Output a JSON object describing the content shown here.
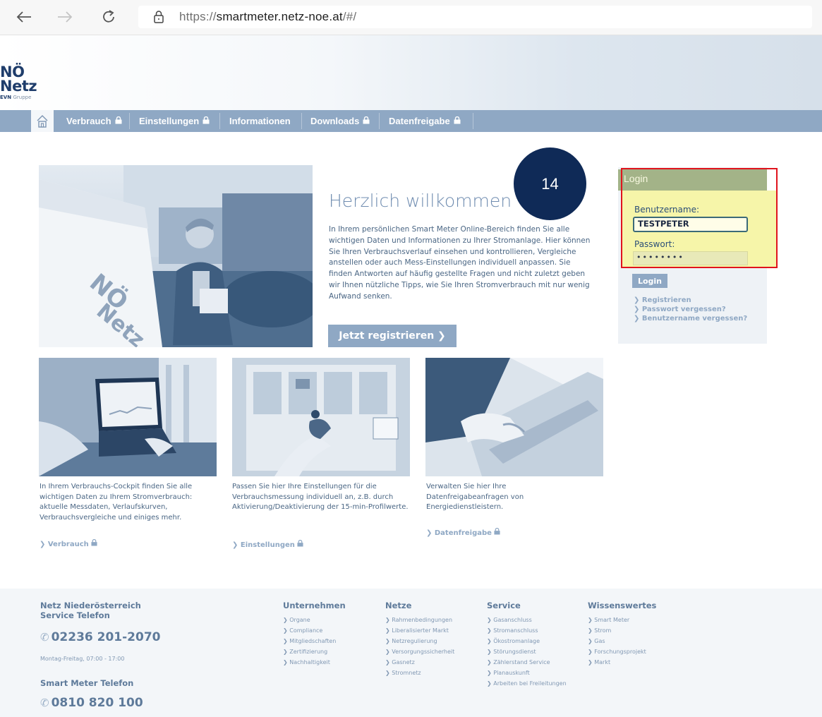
{
  "browser": {
    "url_prefix": "https://",
    "url_host": "smartmeter.netz-noe.at",
    "url_path": "/#/"
  },
  "logo": {
    "line1": "NÖ",
    "line2": "Netz",
    "evn": "EVN",
    "gruppe": "Gruppe"
  },
  "nav": {
    "items": [
      {
        "label": "Verbrauch",
        "locked": true
      },
      {
        "label": "Einstellungen",
        "locked": true
      },
      {
        "label": "Informationen",
        "locked": false
      },
      {
        "label": "Downloads",
        "locked": true
      },
      {
        "label": "Datenfreigabe",
        "locked": true
      }
    ]
  },
  "hero": {
    "title": "Herzlich willkommen",
    "text": "In Ihrem persönlichen Smart Meter Online-Bereich finden Sie alle wichtigen Daten und Informationen zu Ihrer Stromanlage. Hier können Sie Ihren Verbrauchsverlauf einsehen und kontrollieren, Vergleiche anstellen oder auch Mess-Einstellungen individuell anpassen. Sie finden Antworten auf häufig gestellte Fragen und nicht zuletzt geben wir Ihnen nützliche Tipps, wie Sie Ihren Stromverbrauch mit nur wenig Aufwand senken.",
    "register_button": "Jetzt registrieren ❯"
  },
  "badge": "14",
  "login": {
    "title": "Login",
    "username_label": "Benutzername:",
    "username_value": "TESTPETER",
    "password_label": "Passwort:",
    "password_value": "••••••••",
    "button": "Login",
    "links": [
      "❯ Registrieren",
      "❯ Passwort vergessen?",
      "❯ Benutzername vergessen?"
    ]
  },
  "tiles": [
    {
      "text": "In Ihrem Verbrauchs-Cockpit finden Sie alle wichtigen Daten zu Ihrem Stromverbrauch: aktuelle Messdaten, Verlaufskurven, Verbrauchsvergleiche und einiges mehr.",
      "link": "❯ Verbrauch"
    },
    {
      "text": "Passen Sie hier Ihre Einstellungen für die Verbrauchsmessung individuell an, z.B. durch Aktivierung/Deaktivierung der 15-min-Profilwerte.",
      "link": "❯ Einstellungen"
    },
    {
      "text": "Verwalten Sie hier Ihre Datenfreigabeanfragen von Energiedienstleistern.",
      "link": "❯ Datenfreigabe"
    }
  ],
  "footer": {
    "contact_title_1": "Netz Niederösterreich",
    "contact_title_2": "Service Telefon",
    "service_phone": "02236 201-2070",
    "hours": "Montag-Freitag, 07:00 - 17:00",
    "smart_meter_title": "Smart Meter Telefon",
    "smart_meter_phone": "0810 820 100",
    "columns": [
      {
        "title": "Unternehmen",
        "items": [
          "❯ Organe",
          "❯ Compliance",
          "❯ Mitgliedschaften",
          "❯ Zertifizierung",
          "❯ Nachhaltigkeit"
        ]
      },
      {
        "title": "Netze",
        "items": [
          "❯ Rahmenbedingungen",
          "❯ Liberalisierter Markt",
          "❯ Netzregulierung",
          "❯ Versorgungssicherheit",
          "❯ Gasnetz",
          "❯ Stromnetz"
        ]
      },
      {
        "title": "Service",
        "items": [
          "❯ Gasanschluss",
          "❯ Stromanschluss",
          "❯ Ökostromanlage",
          "❯ Störungsdienst",
          "❯ Zählerstand Service",
          "❯ Planauskunft",
          "❯ Arbeiten bei Freileitungen"
        ]
      },
      {
        "title": "Wissenswertes",
        "items": [
          "❯ Smart Meter",
          "❯ Strom",
          "❯ Gas",
          "❯ Forschungsprojekt",
          "❯ Markt"
        ]
      }
    ]
  },
  "colors": {
    "nav": "#8fa8c4",
    "login_head": "#a3b388",
    "highlight": "#f6f5a9",
    "annotation_frame": "#e0131d",
    "badge": "#0f2a57"
  }
}
